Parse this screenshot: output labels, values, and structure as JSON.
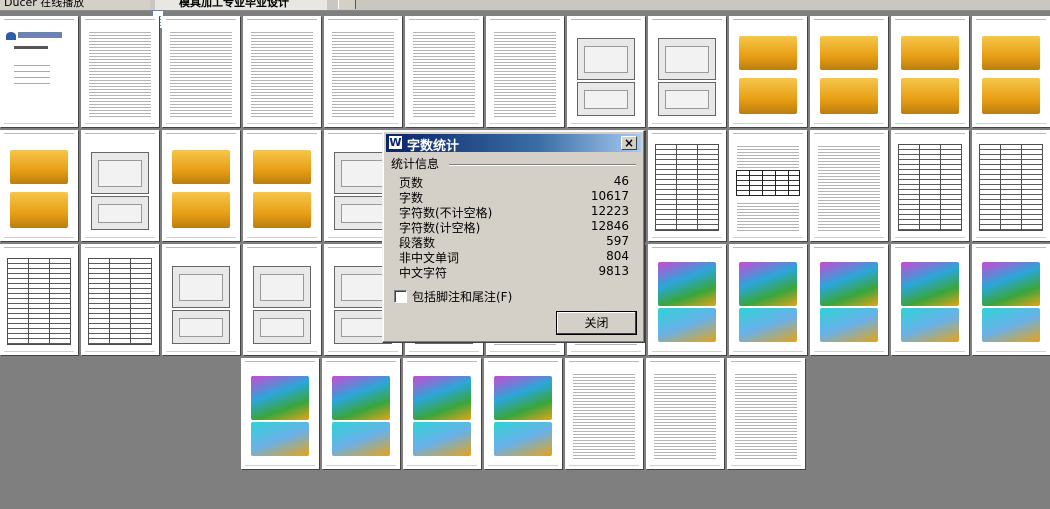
{
  "taskbar": {
    "left_item": "Ducer 在线播放",
    "active_doc": "模具加工专业毕业设计"
  },
  "dialog": {
    "title": "字数统计",
    "close_glyph": "×",
    "group_title": "统计信息",
    "stats": [
      {
        "label": "页数",
        "value": "46"
      },
      {
        "label": "字数",
        "value": "10617"
      },
      {
        "label": "字符数(不计空格)",
        "value": "12223"
      },
      {
        "label": "字符数(计空格)",
        "value": "12846"
      },
      {
        "label": "段落数",
        "value": "597"
      },
      {
        "label": "非中文单词",
        "value": "804"
      },
      {
        "label": "中文字符",
        "value": "9813"
      }
    ],
    "checkbox_label": "包括脚注和尾注(F)",
    "checkbox_checked": false,
    "close_button": "关闭"
  },
  "thumbnails": [
    [
      "cover",
      "lines",
      "lines",
      "lines",
      "lines",
      "lines",
      "lines",
      "shots",
      "shots",
      "yellow",
      "yellow",
      "yellow",
      "yellow"
    ],
    [
      "yellow",
      "shots",
      "yellow",
      "yellow",
      "shots",
      "text",
      "text",
      "lines",
      "table",
      "tables",
      "lines",
      "table",
      "table"
    ],
    [
      "table",
      "table",
      "shots",
      "shots",
      "shots",
      "shots",
      "lines",
      "lines",
      "cam",
      "cam",
      "cam",
      "cam",
      "cam"
    ],
    [
      "cam",
      "cam",
      "cam",
      "cam",
      "lines",
      "lines",
      "lines"
    ]
  ]
}
